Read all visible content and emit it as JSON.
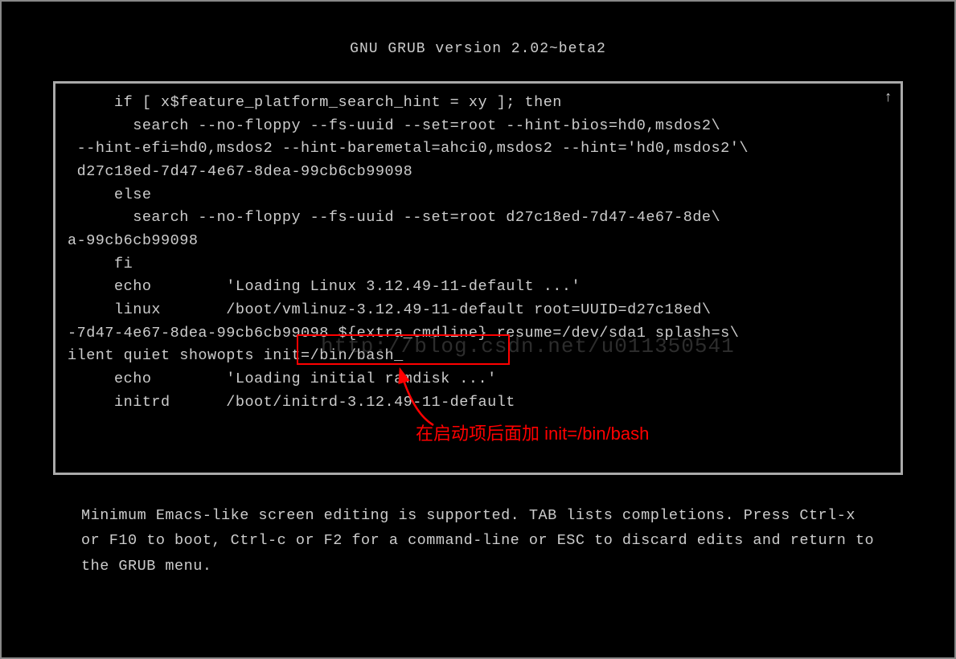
{
  "header": {
    "title": "GNU GRUB  version 2.02~beta2"
  },
  "editor": {
    "content": "     if [ x$feature_platform_search_hint = xy ]; then\n       search --no-floppy --fs-uuid --set=root --hint-bios=hd0,msdos2\\\n --hint-efi=hd0,msdos2 --hint-baremetal=ahci0,msdos2 --hint='hd0,msdos2'\\\n d27c18ed-7d47-4e67-8dea-99cb6cb99098\n     else\n       search --no-floppy --fs-uuid --set=root d27c18ed-7d47-4e67-8de\\\na-99cb6cb99098\n     fi\n     echo        'Loading Linux 3.12.49-11-default ...'\n     linux       /boot/vmlinuz-3.12.49-11-default root=UUID=d27c18ed\\\n-7d47-4e67-8dea-99cb6cb99098 ${extra_cmdline} resume=/dev/sda1 splash=s\\\nilent quiet showopts init=/bin/bash_\n     echo        'Loading initial ramdisk ...'\n     initrd      /boot/initrd-3.12.49-11-default",
    "scroll_indicator": "↑"
  },
  "watermark": {
    "text": "http://blog.csdn.net/u011350541"
  },
  "annotation": {
    "text": "在启动项后面加 init=/bin/bash"
  },
  "footer": {
    "text": "Minimum Emacs-like screen editing is supported. TAB lists completions. Press Ctrl-x or F10 to boot, Ctrl-c or F2 for a command-line or ESC to discard edits and return to the GRUB menu."
  }
}
